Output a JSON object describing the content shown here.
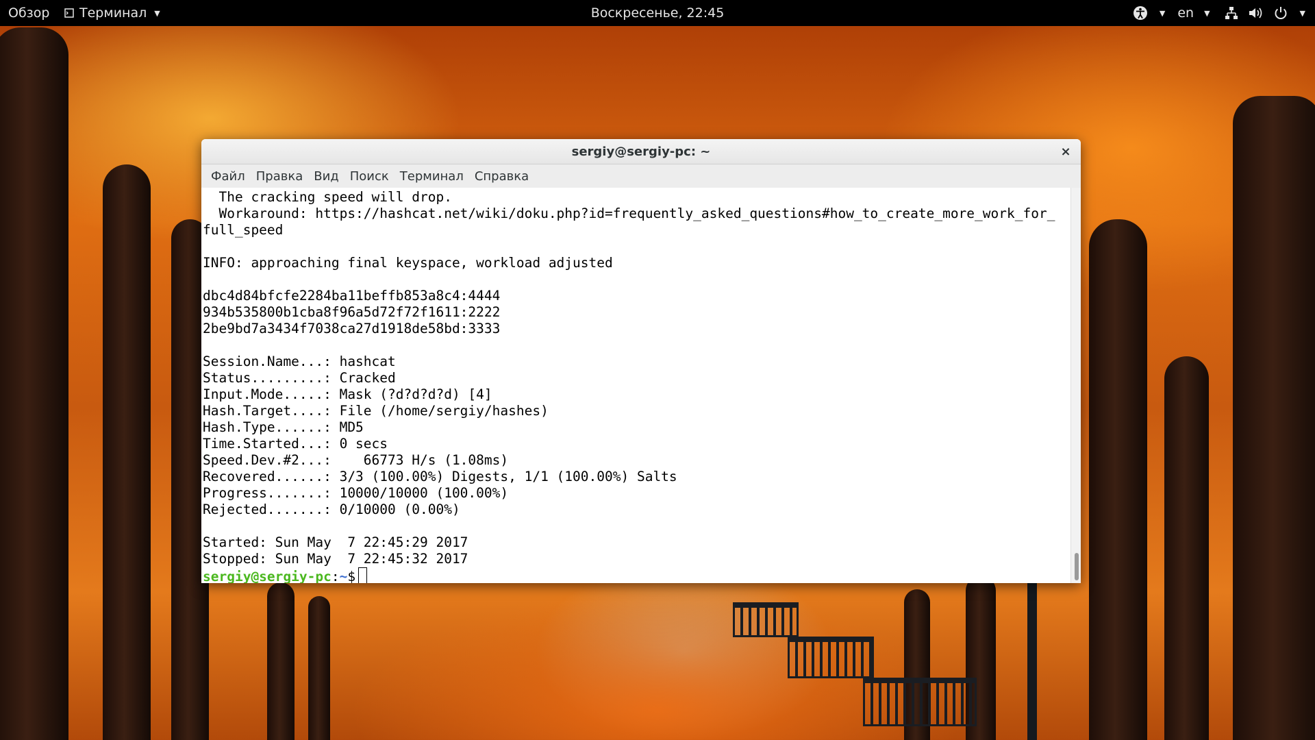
{
  "topbar": {
    "overview": "Обзор",
    "app_menu": "Терминал",
    "clock": "Воскресенье, 22:45",
    "language": "en"
  },
  "window": {
    "title": "sergiy@sergiy-pc: ~",
    "close_glyph": "×",
    "menu": [
      "Файл",
      "Правка",
      "Вид",
      "Поиск",
      "Терминал",
      "Справка"
    ]
  },
  "terminal": {
    "lines": [
      "  The cracking speed will drop.",
      "  Workaround: https://hashcat.net/wiki/doku.php?id=frequently_asked_questions#how_to_create_more_work_for_",
      "full_speed",
      "",
      "INFO: approaching final keyspace, workload adjusted",
      "",
      "dbc4d84bfcfe2284ba11beffb853a8c4:4444",
      "934b535800b1cba8f96a5d72f72f1611:2222",
      "2be9bd7a3434f7038ca27d1918de58bd:3333",
      "",
      "Session.Name...: hashcat",
      "Status.........: Cracked",
      "Input.Mode.....: Mask (?d?d?d?d) [4]",
      "Hash.Target....: File (/home/sergiy/hashes)",
      "Hash.Type......: MD5",
      "Time.Started...: 0 secs",
      "Speed.Dev.#2...:    66773 H/s (1.08ms)",
      "Recovered......: 3/3 (100.00%) Digests, 1/1 (100.00%) Salts",
      "Progress.......: 10000/10000 (100.00%)",
      "Rejected.......: 0/10000 (0.00%)",
      "",
      "Started: Sun May  7 22:45:29 2017",
      "Stopped: Sun May  7 22:45:32 2017"
    ],
    "prompt_user": "sergiy@sergiy-pc",
    "prompt_sep": ":",
    "prompt_path": "~",
    "prompt_symbol": "$"
  },
  "icons": {
    "app_menu": "terminal-icon",
    "accessibility": "accessibility-icon",
    "network": "network-icon",
    "volume": "volume-icon",
    "power": "power-icon"
  },
  "colors": {
    "prompt_user": "#4bb81f",
    "prompt_path": "#3f6fd0",
    "topbar_bg": "#000000"
  }
}
